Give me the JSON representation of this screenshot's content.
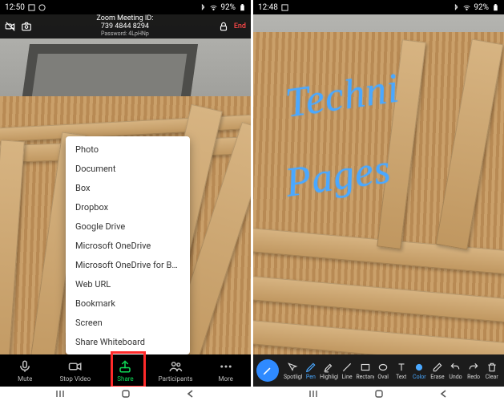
{
  "left": {
    "status": {
      "time": "12:50",
      "battery": "92%"
    },
    "zoomTop": {
      "meetingIdLabel": "Zoom Meeting ID:",
      "meetingId": "739 4844 8294",
      "password": "Password: 4LpHNp",
      "end": "End"
    },
    "shareMenu": [
      "Photo",
      "Document",
      "Box",
      "Dropbox",
      "Google Drive",
      "Microsoft OneDrive",
      "Microsoft OneDrive for Business",
      "Web URL",
      "Bookmark",
      "Screen",
      "Share Whiteboard"
    ],
    "bottom": {
      "mute": "Mute",
      "stopVideo": "Stop Video",
      "share": "Share",
      "participants": "Participants",
      "more": "More"
    }
  },
  "right": {
    "status": {
      "time": "12:48",
      "battery": "92%"
    },
    "annotation": {
      "line1": "Techni",
      "line2": "Pages"
    },
    "tools": {
      "spotlight": "Spotlight",
      "pen": "Pen",
      "highlight": "Highlight",
      "line": "Line",
      "rectangle": "Rectangle",
      "oval": "Oval",
      "text": "Text",
      "color": "Color",
      "erase": "Erase",
      "undo": "Undo",
      "redo": "Redo",
      "clear": "Clear"
    }
  }
}
